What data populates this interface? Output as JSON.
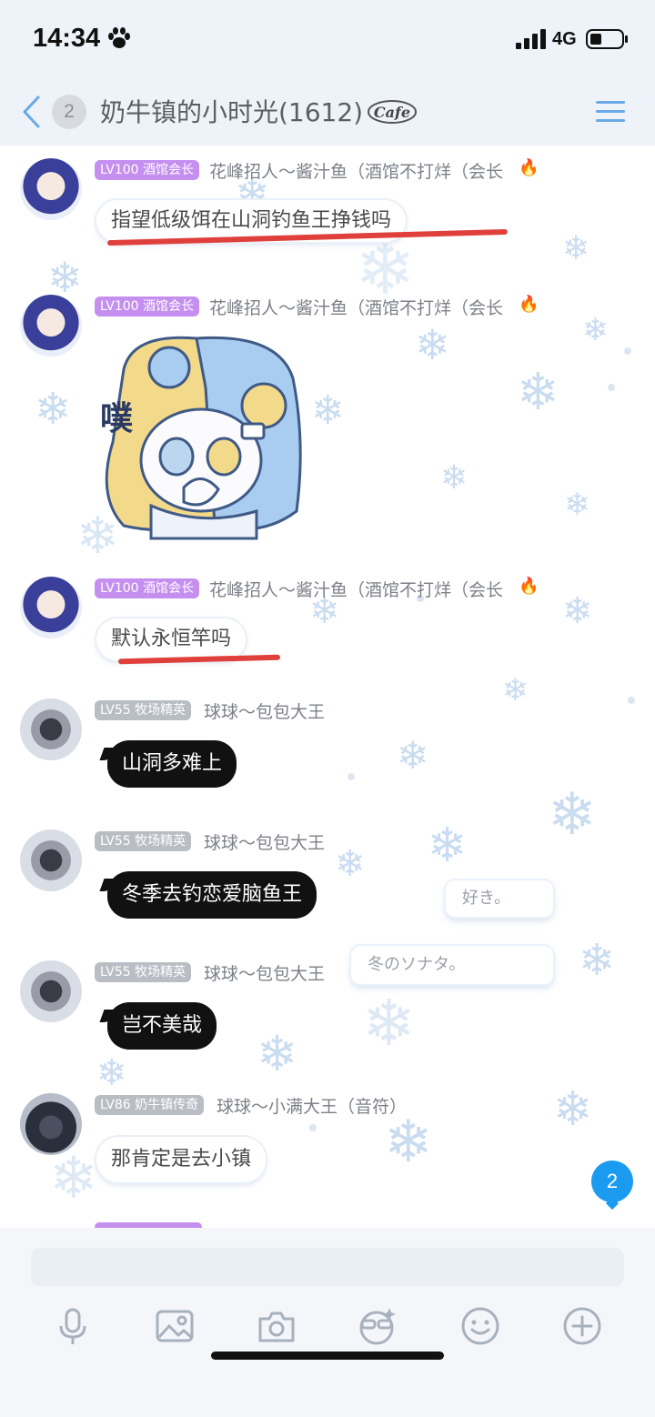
{
  "status_bar": {
    "time": "14:34",
    "network": "4G"
  },
  "nav": {
    "unread_count": "2",
    "title": "奶牛镇的小时光(1612)",
    "logo_text": "Cafe"
  },
  "messages": [
    {
      "level": "LV100 酒馆会长",
      "sender": "花峰招人～酱汁鱼（酒馆不打烊（会长",
      "text": "指望低级饵在山洞钓鱼王挣钱吗"
    },
    {
      "level": "LV100 酒馆会长",
      "sender": "花峰招人～酱汁鱼（酒馆不打烊（会长",
      "sticker_text": "噗"
    },
    {
      "level": "LV100 酒馆会长",
      "sender": "花峰招人～酱汁鱼（酒馆不打烊（会长",
      "text": "默认永恒竿吗"
    },
    {
      "level": "LV55 牧场精英",
      "sender": "球球～包包大王",
      "text": "山洞多难上"
    },
    {
      "level": "LV55 牧场精英",
      "sender": "球球～包包大王",
      "text": "冬季去钓恋爱脑鱼王"
    },
    {
      "level": "LV55 牧场精英",
      "sender": "球球～包包大王",
      "text": "岂不美哉"
    },
    {
      "level": "LV86 奶牛镇传奇",
      "sender": "球球～小满大王（音符）",
      "text": "那肯定是去小镇"
    }
  ],
  "floating_notes": [
    "好き。",
    "冬のソナタ。"
  ],
  "new_message_count": "2",
  "toolbar_icons": [
    "microphone-icon",
    "image-icon",
    "camera-icon",
    "glasses-emoji-icon",
    "smiley-icon",
    "plus-icon"
  ],
  "colors": {
    "accent_blue": "#1a9bf0",
    "tag_purple": "#c58ff0",
    "tag_gray": "#b9bdc4",
    "underline_red": "#e0403c"
  }
}
